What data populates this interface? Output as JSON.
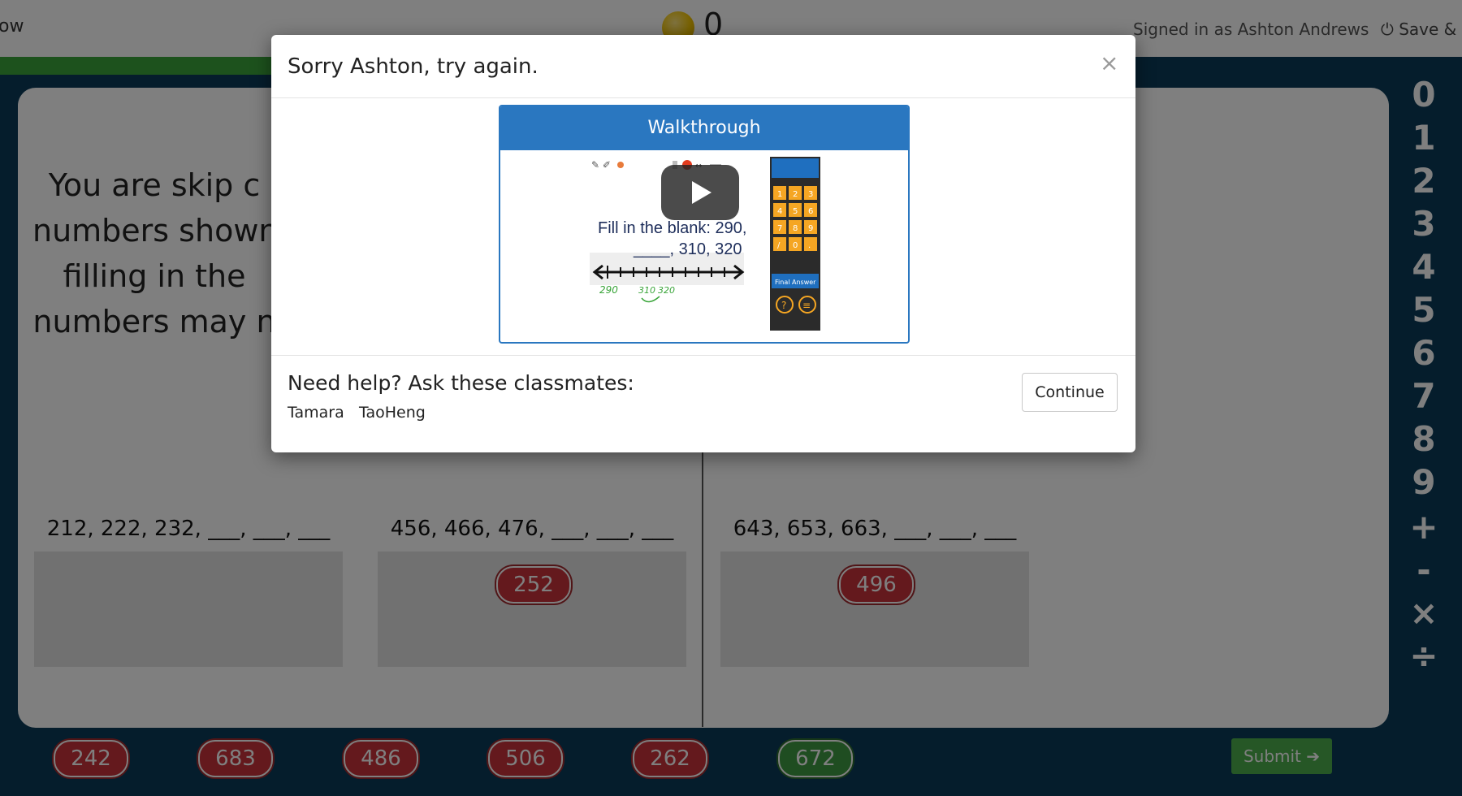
{
  "header": {
    "left_partial": "ow",
    "coin_count": "0",
    "signed_in": "Signed in as Ashton Andrews",
    "save_label": "Save & C",
    "save_icon": "power-icon",
    "progress_fraction": 0.25
  },
  "prompt": {
    "lines": [
      "You are skip c",
      "numbers shown",
      "filling in the",
      "numbers may n"
    ]
  },
  "sequences": [
    {
      "label": "212, 222, 232, ___, ___, ___",
      "tiles": []
    },
    {
      "label": "456, 466, 476, ___, ___, ___",
      "tiles": [
        "252"
      ]
    },
    {
      "label": "643, 653, 663, ___, ___, ___",
      "tiles": [
        "496"
      ]
    }
  ],
  "answer_bank": [
    {
      "value": "242",
      "color": "red"
    },
    {
      "value": "683",
      "color": "red"
    },
    {
      "value": "486",
      "color": "red"
    },
    {
      "value": "506",
      "color": "red"
    },
    {
      "value": "262",
      "color": "red"
    },
    {
      "value": "672",
      "color": "green"
    }
  ],
  "submit": {
    "label": "Submit",
    "icon": "arrow-right-icon"
  },
  "keypad": [
    "0",
    "1",
    "2",
    "3",
    "4",
    "5",
    "6",
    "7",
    "8",
    "9",
    "+",
    "-",
    "×",
    "÷"
  ],
  "modal": {
    "title": "Sorry Ashton, try again.",
    "close": "×",
    "walkthrough": {
      "header": "Walkthrough",
      "video_text_line1": "Fill in the blank: 290,",
      "video_text_line2": "____, 310, 320",
      "video_axis_labels": [
        "290",
        "310",
        "320"
      ],
      "calc_keys": [
        "1",
        "2",
        "3",
        "4",
        "5",
        "6",
        "7",
        "8",
        "9",
        "/",
        "0",
        "."
      ],
      "calc_final": "Final Answer"
    },
    "help_title": "Need help? Ask these classmates:",
    "classmates": [
      "Tamara",
      "TaoHeng"
    ],
    "continue_label": "Continue"
  },
  "colors": {
    "background": "#0a3a58",
    "progress": "#3aa53a",
    "tile_red": "#c8323b",
    "tile_green": "#3f9a43",
    "submit": "#4daf4d",
    "walkthrough_blue": "#2a77c0",
    "calc_orange": "#f5a623"
  }
}
